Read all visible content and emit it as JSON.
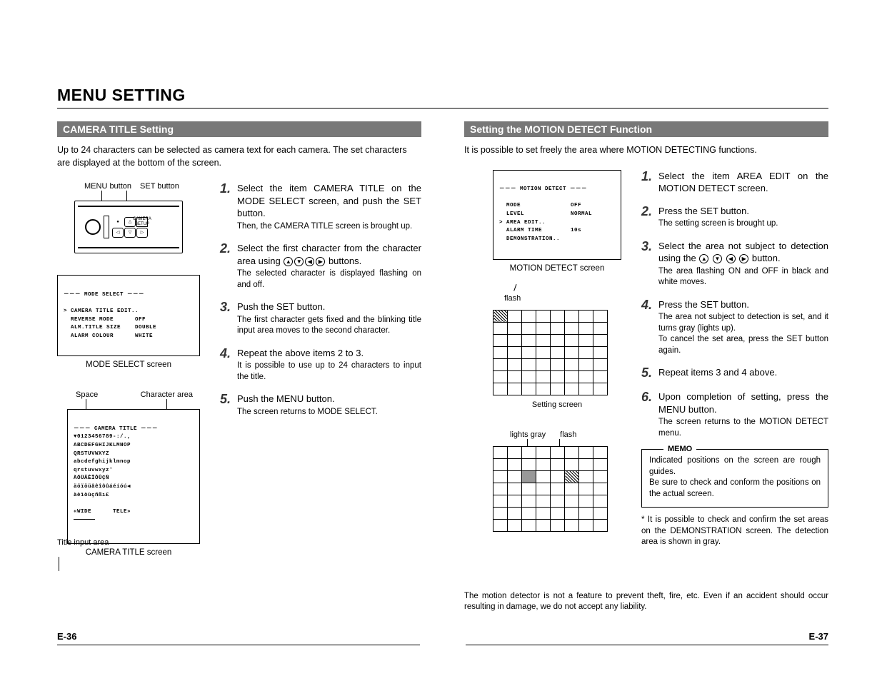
{
  "title": "MENU SETTING",
  "left": {
    "heading": "CAMERA TITLE Setting",
    "intro": "Up to 24 characters can be selected as camera text for each camera. The set characters are displayed at the bottom of the screen.",
    "annot_menu_btn": "MENU button",
    "annot_set_btn": "SET button",
    "mode_select": {
      "header": "－－－ MODE SELECT －－－",
      "rows": [
        "> CAMERA TITLE EDIT..",
        "  REVERSE MODE      OFF",
        "  ALM.TITLE SIZE    DOUBLE",
        "  ALARM COLOUR      WHITE"
      ],
      "caption": "MODE SELECT screen"
    },
    "camera_title": {
      "annot_space": "Space",
      "annot_chararea": "Character area",
      "header": "－－－ CAMERA TITLE －－－",
      "rows": [
        "▼0123456789-:/.,",
        "ABCDEFGHIJKLMNOP",
        "QRSTUVWXYZ",
        "abcdefghijklmnop",
        "qrstuvwxyz'",
        "ÄÖÜÂÊÎÔÛÇÑ",
        "äöïöüâêîôûáéíóú◀",
        "àèìòùçñßı£"
      ],
      "footer": "«WIDE      TELE»",
      "caption": "CAMERA TITLE screen",
      "annot_input": "Title input area"
    },
    "steps": [
      {
        "n": "1.",
        "lead": "Select the item CAMERA TITLE on the MODE SELECT screen, and push the SET button.",
        "detail": "Then, the CAMERA TITLE screen is brought up."
      },
      {
        "n": "2.",
        "lead": "Select the first character from the character area using ◯◯◯◯ buttons.",
        "detail": "The selected character is displayed flashing on and off."
      },
      {
        "n": "3.",
        "lead": "Push the SET button.",
        "detail": "The first character gets fixed and the blinking title input area moves to the second character."
      },
      {
        "n": "4.",
        "lead": "Repeat the above items 2 to 3.",
        "detail": "It is possible to use up to 24 characters to input the title."
      },
      {
        "n": "5.",
        "lead": "Push the MENU button.",
        "detail": "The screen returns to MODE SELECT."
      }
    ]
  },
  "right": {
    "heading": "Setting the MOTION DETECT Function",
    "intro": "It is possible to set freely the area where MOTION DETECTING functions.",
    "motion_detect": {
      "header": "－－－ MOTION DETECT －－－",
      "rows": [
        "  MODE              OFF",
        "  LEVEL             NORMAL",
        "> AREA EDIT..",
        "  ALARM TIME        10s",
        "  DEMONSTRATION.."
      ],
      "caption": "MOTION DETECT screen"
    },
    "grid1": {
      "annot_flash": "flash",
      "caption": "Setting screen"
    },
    "grid2": {
      "annot_gray": "lights gray",
      "annot_flash": "flash"
    },
    "steps": [
      {
        "n": "1.",
        "lead": "Select the item AREA EDIT on the MOTION DETECT screen.",
        "detail": ""
      },
      {
        "n": "2.",
        "lead": "Press the SET button.",
        "detail": "The setting screen is brought up."
      },
      {
        "n": "3.",
        "lead": "Select the area not subject to detection using the ◯ ◯ ◯ ◯ button.",
        "detail": "The area flashing ON and OFF in black and white moves."
      },
      {
        "n": "4.",
        "lead": "Press the SET button.",
        "detail": "The area not subject to detection is set, and it turns gray (lights up).\nTo cancel the set area, press the SET button again."
      },
      {
        "n": "5.",
        "lead": "Repeat items 3 and 4 above.",
        "detail": ""
      },
      {
        "n": "6.",
        "lead": "Upon completion of setting, press the MENU button.",
        "detail": "The screen returns to the MOTION DETECT menu."
      }
    ],
    "memo": {
      "title": "MEMO",
      "body": "Indicated positions on the screen are rough guides.\nBe sure to check and conform the positions on the actual screen."
    },
    "footnote": "* It is possible to check and confirm the set areas on the DEMONSTRATION screen. The detection area is shown in gray.",
    "disclaimer": "The motion detector is not a feature to prevent theft, fire, etc.  Even if an accident should occur resulting in damage, we do not accept any liability."
  },
  "page_left": "E-36",
  "page_right": "E-37"
}
